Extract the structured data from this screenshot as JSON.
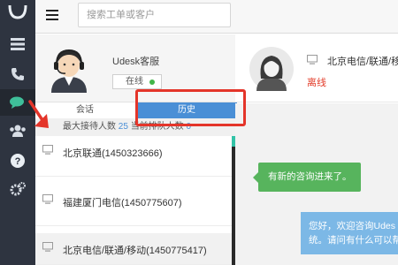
{
  "search": {
    "placeholder": "搜索工单或客户"
  },
  "agent": {
    "name": "Udesk客服",
    "status": "在线"
  },
  "tabs": {
    "session": "会话",
    "history": "历史"
  },
  "stats": {
    "max_label": "最大接待人数",
    "max_value": "25",
    "queue_label": "当前排队人数",
    "queue_value": "0"
  },
  "conversations": [
    {
      "label": "北京联通(1450323666)"
    },
    {
      "label": "福建厦门电信(1450775607)"
    },
    {
      "label": "北京电信/联通/移动(1450775417)"
    }
  ],
  "customer": {
    "name": "北京电信/联通/移",
    "status": "离线"
  },
  "chat": {
    "notice": "有新的咨询进来了。",
    "greeting_line1": "您好，欢迎咨询Udes",
    "greeting_line2": "统。请问有什么可以帮"
  },
  "colors": {
    "nav_bg": "#2e3440",
    "accent_blue": "#4a8fd6",
    "highlight_red": "#e4352a",
    "online_green": "#42b549",
    "offline_red": "#e33d2a",
    "bubble_green": "#57b45d",
    "bubble_blue": "#7cb8e6"
  },
  "icons": [
    "udesk-logo-icon",
    "menu-icon",
    "phone-icon",
    "chat-icon",
    "users-icon",
    "help-icon",
    "settings-icon",
    "monitor-icon"
  ]
}
